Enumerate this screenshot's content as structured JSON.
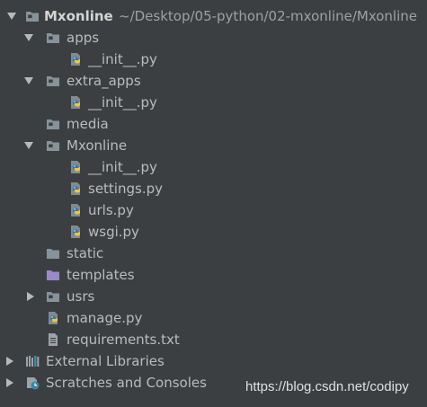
{
  "tree": {
    "root": {
      "name": "Mxonline",
      "path": "~/Desktop/05-python/02-mxonline/Mxonline"
    },
    "items": [
      {
        "label": "apps"
      },
      {
        "label": "__init__.py"
      },
      {
        "label": "extra_apps"
      },
      {
        "label": "__init__.py"
      },
      {
        "label": "media"
      },
      {
        "label": "Mxonline"
      },
      {
        "label": "__init__.py"
      },
      {
        "label": "settings.py"
      },
      {
        "label": "urls.py"
      },
      {
        "label": "wsgi.py"
      },
      {
        "label": "static"
      },
      {
        "label": "templates"
      },
      {
        "label": "usrs"
      },
      {
        "label": "manage.py"
      },
      {
        "label": "requirements.txt"
      }
    ],
    "external_libraries": "External Libraries",
    "scratches": "Scratches and Consoles"
  },
  "watermark": "https://blog.csdn.net/codipy",
  "colors": {
    "background": "#3c3f41",
    "text": "#bbbbbb",
    "folder": "#87939a",
    "templates_folder": "#9b8ac9",
    "python_blue": "#3c76ab",
    "python_yellow": "#f2c53d"
  }
}
